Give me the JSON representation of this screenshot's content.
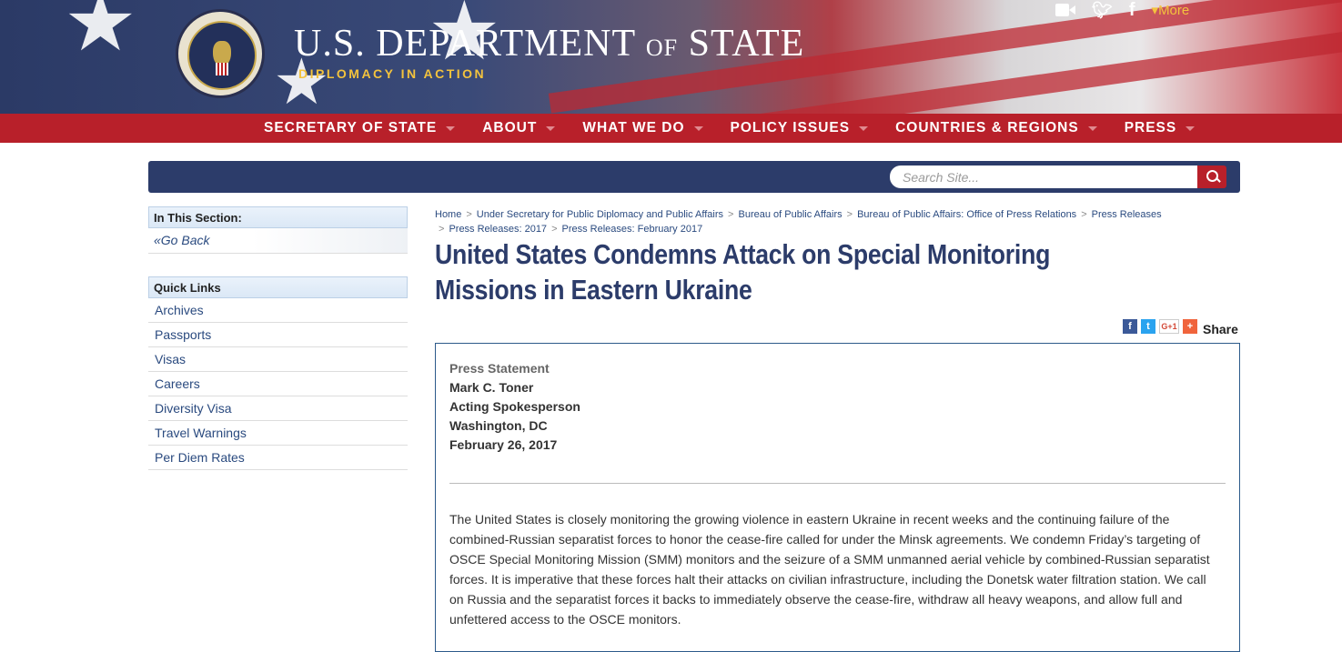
{
  "header": {
    "title_main": "U.S. Department",
    "title_of": "of",
    "title_end": "State",
    "tagline": "DIPLOMACY IN ACTION",
    "more_label": "More"
  },
  "nav": {
    "items": [
      "SECRETARY OF STATE",
      "ABOUT",
      "WHAT WE DO",
      "POLICY ISSUES",
      "COUNTRIES & REGIONS",
      "PRESS"
    ]
  },
  "search": {
    "placeholder": "Search Site..."
  },
  "sidebar": {
    "section_heading": "In This Section:",
    "go_back": "Go Back",
    "quick_links_heading": "Quick Links",
    "links": [
      "Archives",
      "Passports",
      "Visas",
      "Careers",
      "Diversity Visa",
      "Travel Warnings",
      "Per Diem Rates"
    ]
  },
  "breadcrumb": [
    "Home",
    "Under Secretary for Public Diplomacy and Public Affairs",
    "Bureau of Public Affairs",
    "Bureau of Public Affairs: Office of Press Relations",
    "Press Releases",
    "Press Releases: 2017",
    "Press Releases: February 2017"
  ],
  "article": {
    "title": "United States Condemns Attack on Special Monitoring Missions in Eastern Ukraine",
    "share_label": "Share",
    "statement_type": "Press Statement",
    "author": "Mark C. Toner",
    "role": "Acting Spokesperson",
    "location": "Washington, DC",
    "date": "February 26, 2017",
    "body": "The United States is closely monitoring the growing violence in eastern Ukraine in recent weeks and the continuing failure of the combined-Russian separatist forces to honor the cease-fire called for under the Minsk agreements. We condemn Friday’s targeting of OSCE Special Monitoring Mission (SMM) monitors and the seizure of a SMM unmanned aerial vehicle by combined-Russian separatist forces. It is imperative that these forces halt their attacks on civilian infrastructure, including the Donetsk water filtration station. We call on Russia and the separatist forces it backs to immediately observe the cease-fire, withdraw all heavy weapons, and allow full and unfettered access to the OSCE monitors."
  },
  "colors": {
    "navy": "#2c3c6a",
    "red": "#b8202a",
    "gold": "#f3c33d"
  }
}
